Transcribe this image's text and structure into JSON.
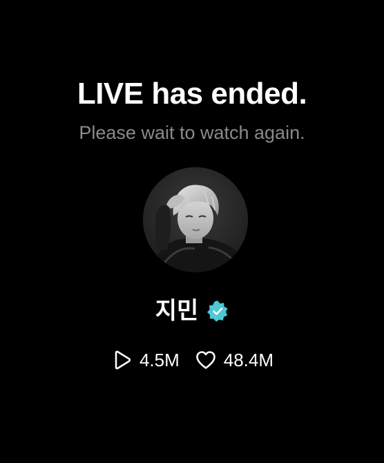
{
  "live_status": {
    "title": "LIVE has ended.",
    "subtitle": "Please wait to watch again."
  },
  "artist": {
    "name": "지민",
    "verified": true,
    "badge_color": "#4cc9d4"
  },
  "stats": {
    "plays": {
      "icon": "play-icon",
      "value": "4.5M"
    },
    "likes": {
      "icon": "heart-icon",
      "value": "48.4M"
    }
  },
  "colors": {
    "background": "#000000",
    "title": "#ffffff",
    "subtitle": "#8a8a8a"
  }
}
